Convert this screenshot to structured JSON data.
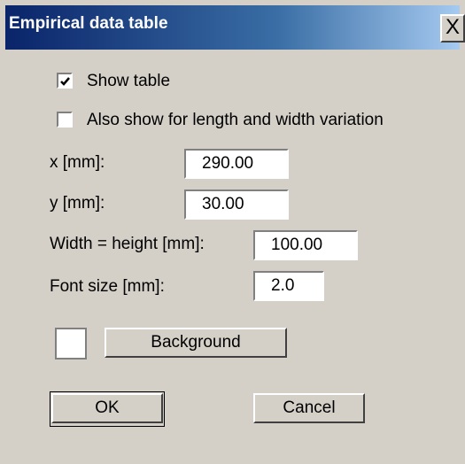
{
  "window": {
    "title": "Empirical data table",
    "close_glyph": "X"
  },
  "checkboxes": [
    {
      "label": "Show table",
      "checked": true
    },
    {
      "label": "Also show for length and width variation",
      "checked": false
    }
  ],
  "fields": {
    "x": {
      "label": "x [mm]:",
      "value": "290.00"
    },
    "y": {
      "label": "y [mm]:",
      "value": "30.00"
    },
    "width_height": {
      "label": "Width = height [mm]:",
      "value": "100.00"
    },
    "font_size": {
      "label": "Font size [mm]:",
      "value": "2.0"
    }
  },
  "background": {
    "button_label": "Background",
    "swatch_color": "#ffffff"
  },
  "buttons": {
    "ok": "OK",
    "cancel": "Cancel"
  },
  "colors": {
    "face": "#d4d0c8",
    "title_start": "#0a246a",
    "title_end": "#a6caf0"
  },
  "icons": {
    "close": "close-icon",
    "check": "check-icon"
  }
}
